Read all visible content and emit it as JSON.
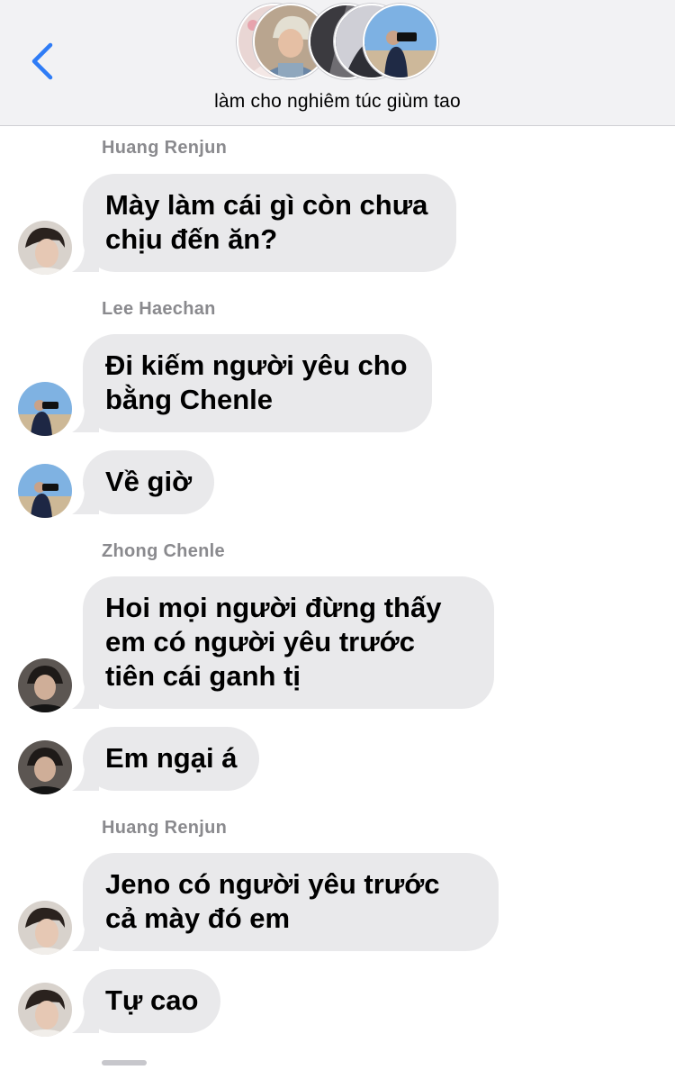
{
  "header": {
    "back_label": "<",
    "group_name": "làm cho nghiêm túc giùm tao",
    "avatars": [
      "avatar-girl-flowers",
      "avatar-blonde",
      "avatar-dark-1",
      "avatar-dark-2",
      "avatar-camera"
    ]
  },
  "messages": [
    {
      "sender": "Huang Renjun",
      "text": "Mày làm cái gì còn chưa chịu đến ăn?"
    },
    {
      "sender": "Lee Haechan",
      "text": "Đi kiếm người yêu cho bằng Chenle"
    },
    {
      "text": "Về giờ"
    },
    {
      "sender": "Zhong Chenle",
      "text": "Hoi mọi người đừng thấy em có người yêu trước tiên cái ganh tị"
    },
    {
      "text": "Em ngại á"
    },
    {
      "sender": "Huang Renjun",
      "text": "Jeno có người yêu trước cả mày đó em"
    },
    {
      "text": "Tự cao"
    }
  ],
  "colors": {
    "header_bg": "#f2f2f4",
    "bubble_bg": "#e9e9eb",
    "accent": "#2f7cf6",
    "sender_label": "#8a8a8e"
  }
}
